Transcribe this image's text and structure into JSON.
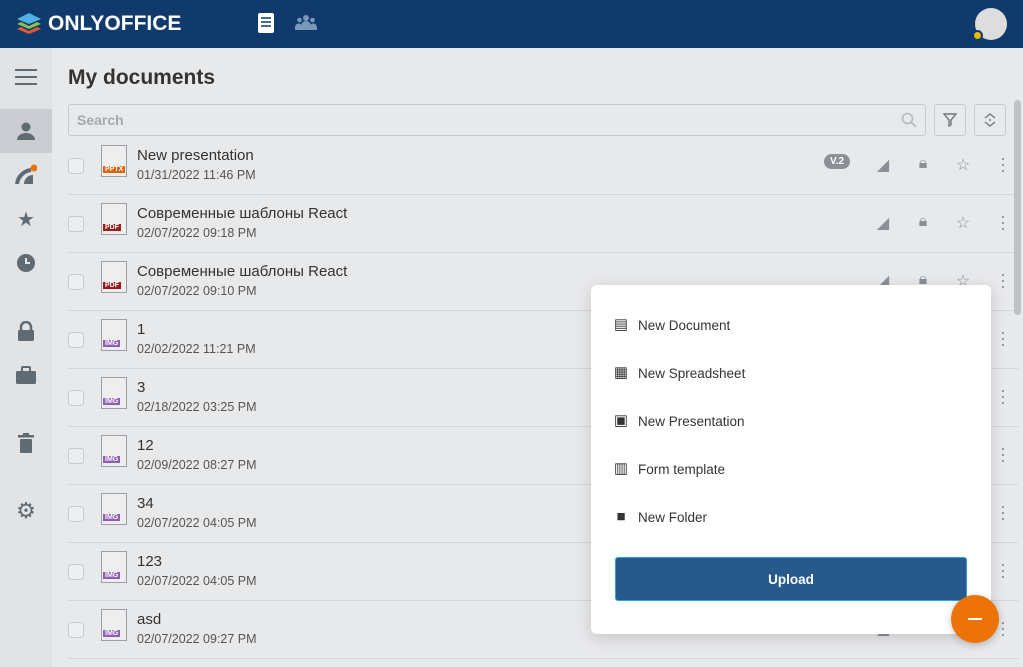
{
  "header": {
    "brand": "ONLYOFFICE",
    "avatar_badge_color": "#e8b900"
  },
  "page": {
    "title": "My documents",
    "search_placeholder": "Search"
  },
  "sidebar": [
    "menu-icon",
    "person-icon",
    "feed-icon",
    "star-icon",
    "clock-icon",
    "lock-icon",
    "briefcase-icon",
    "trash-icon",
    "gear-icon"
  ],
  "files": [
    {
      "name": "New presentation",
      "date": "01/31/2022 11:46 PM",
      "type": "PPTX",
      "version": "V.2"
    },
    {
      "name": "Современные шаблоны React",
      "date": "02/07/2022 09:18 PM",
      "type": "PDF"
    },
    {
      "name": "Современные шаблоны React",
      "date": "02/07/2022 09:10 PM",
      "type": "PDF"
    },
    {
      "name": "1",
      "date": "02/02/2022 11:21 PM",
      "type": "IMG"
    },
    {
      "name": "3",
      "date": "02/18/2022 03:25 PM",
      "type": "IMG"
    },
    {
      "name": "12",
      "date": "02/09/2022 08:27 PM",
      "type": "IMG"
    },
    {
      "name": "34",
      "date": "02/07/2022 04:05 PM",
      "type": "IMG"
    },
    {
      "name": "123",
      "date": "02/07/2022 04:05 PM",
      "type": "IMG"
    },
    {
      "name": "asd",
      "date": "02/07/2022 09:27 PM",
      "type": "IMG"
    }
  ],
  "menu": {
    "items": [
      "New Document",
      "New Spreadsheet",
      "New Presentation",
      "Form template",
      "New Folder"
    ],
    "upload": "Upload"
  },
  "colors": {
    "header": "#0f3a6b",
    "accent": "#ed7309",
    "upload": "#265a8d"
  }
}
